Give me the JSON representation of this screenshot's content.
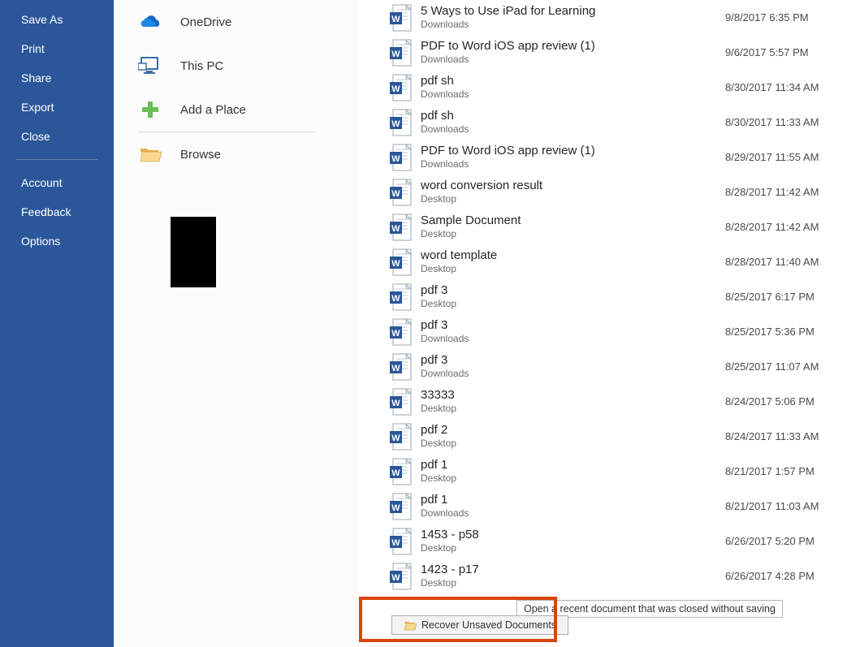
{
  "sidebar": {
    "items_top": [
      {
        "label": "Save As"
      },
      {
        "label": "Print"
      },
      {
        "label": "Share"
      },
      {
        "label": "Export"
      },
      {
        "label": "Close"
      }
    ],
    "items_bottom": [
      {
        "label": "Account"
      },
      {
        "label": "Feedback"
      },
      {
        "label": "Options"
      }
    ]
  },
  "locations": [
    {
      "icon": "onedrive-icon",
      "label": "OneDrive"
    },
    {
      "icon": "thispc-icon",
      "label": "This PC"
    },
    {
      "icon": "addplace-icon",
      "label": "Add a Place"
    },
    {
      "icon": "browse-icon",
      "label": "Browse"
    }
  ],
  "files": [
    {
      "name": "5 Ways to Use iPad for Learning",
      "loc": "Downloads",
      "date": "9/8/2017 6:35 PM"
    },
    {
      "name": "PDF to Word iOS app review (1)",
      "loc": "Downloads",
      "date": "9/6/2017 5:57 PM"
    },
    {
      "name": "pdf sh",
      "loc": "Downloads",
      "date": "8/30/2017 11:34 AM"
    },
    {
      "name": "pdf sh",
      "loc": "Downloads",
      "date": "8/30/2017 11:33 AM"
    },
    {
      "name": "PDF to Word iOS app review (1)",
      "loc": "Downloads",
      "date": "8/29/2017 11:55 AM"
    },
    {
      "name": "word conversion result",
      "loc": "Desktop",
      "date": "8/28/2017 11:42 AM"
    },
    {
      "name": "Sample Document",
      "loc": "Desktop",
      "date": "8/28/2017 11:42 AM"
    },
    {
      "name": "word template",
      "loc": "Desktop",
      "date": "8/28/2017 11:40 AM"
    },
    {
      "name": "pdf 3",
      "loc": "Desktop",
      "date": "8/25/2017 6:17 PM"
    },
    {
      "name": "pdf 3",
      "loc": "Downloads",
      "date": "8/25/2017 5:36 PM"
    },
    {
      "name": "pdf 3",
      "loc": "Downloads",
      "date": "8/25/2017 11:07 AM"
    },
    {
      "name": "33333",
      "loc": "Desktop",
      "date": "8/24/2017 5:06 PM"
    },
    {
      "name": "pdf 2",
      "loc": "Desktop",
      "date": "8/24/2017 11:33 AM"
    },
    {
      "name": "pdf 1",
      "loc": "Desktop",
      "date": "8/21/2017 1:57 PM"
    },
    {
      "name": "pdf 1",
      "loc": "Downloads",
      "date": "8/21/2017 11:03 AM"
    },
    {
      "name": "1453 - p58",
      "loc": "Desktop",
      "date": "6/26/2017 5:20 PM"
    },
    {
      "name": "1423 - p17",
      "loc": "Desktop",
      "date": "6/26/2017 4:28 PM"
    }
  ],
  "recover": {
    "button": "Recover Unsaved Documents",
    "tooltip": "Open a recent document that was closed without saving"
  }
}
